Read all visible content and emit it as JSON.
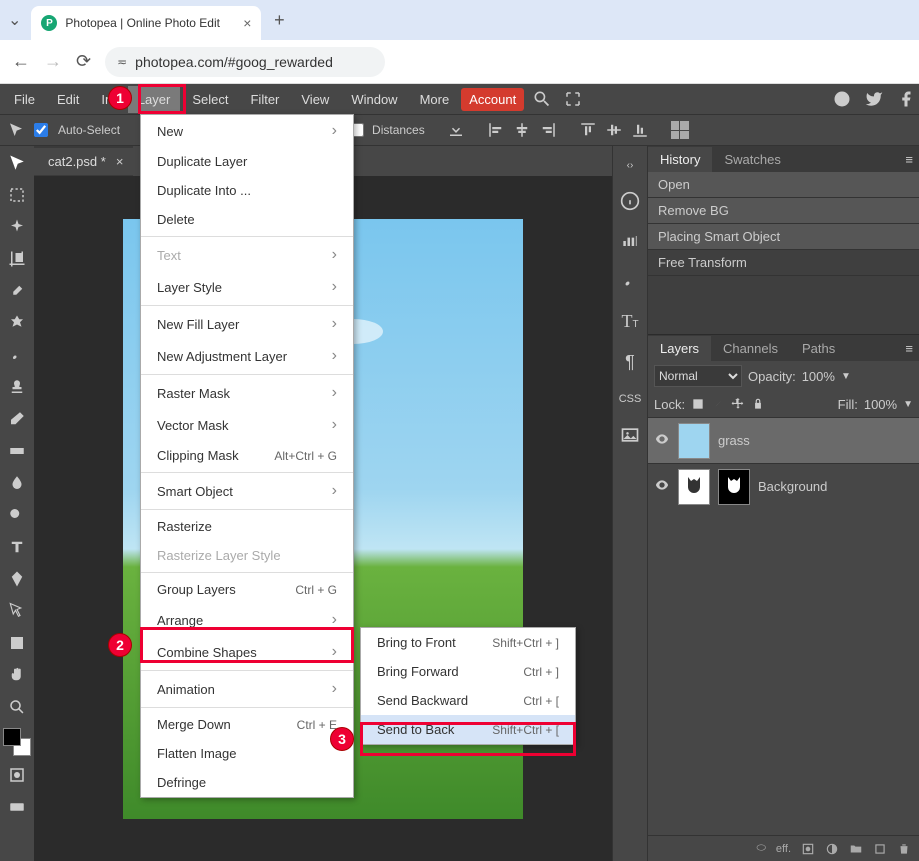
{
  "browser": {
    "tab_title": "Photopea | Online Photo Edit",
    "url": "photopea.com/#goog_rewarded"
  },
  "menubar": {
    "items": [
      "File",
      "Edit",
      "Im",
      "Layer",
      "Select",
      "Filter",
      "View",
      "Window",
      "More"
    ],
    "account": "Account"
  },
  "optbar": {
    "autoselect": "Auto-Select",
    "distances": "Distances"
  },
  "doc_tab": "cat2.psd *",
  "layer_menu": [
    {
      "label": "New",
      "sub": true
    },
    {
      "label": "Duplicate Layer"
    },
    {
      "label": "Duplicate Into ..."
    },
    {
      "label": "Delete"
    },
    {
      "hr": true
    },
    {
      "label": "Text",
      "sub": true,
      "disabled": true
    },
    {
      "label": "Layer Style",
      "sub": true
    },
    {
      "hr": true
    },
    {
      "label": "New Fill Layer",
      "sub": true
    },
    {
      "label": "New Adjustment Layer",
      "sub": true
    },
    {
      "hr": true
    },
    {
      "label": "Raster Mask",
      "sub": true
    },
    {
      "label": "Vector Mask",
      "sub": true
    },
    {
      "label": "Clipping Mask",
      "shortcut": "Alt+Ctrl + G"
    },
    {
      "hr": true
    },
    {
      "label": "Smart Object",
      "sub": true
    },
    {
      "hr": true
    },
    {
      "label": "Rasterize"
    },
    {
      "label": "Rasterize Layer Style",
      "disabled": true
    },
    {
      "hr": true
    },
    {
      "label": "Group Layers",
      "shortcut": "Ctrl + G"
    },
    {
      "label": "Arrange",
      "sub": true
    },
    {
      "label": "Combine Shapes",
      "sub": true
    },
    {
      "hr": true
    },
    {
      "label": "Animation",
      "sub": true
    },
    {
      "hr": true
    },
    {
      "label": "Merge Down",
      "shortcut": "Ctrl + E"
    },
    {
      "label": "Flatten Image"
    },
    {
      "label": "Defringe"
    }
  ],
  "arrange_menu": [
    {
      "label": "Bring to Front",
      "shortcut": "Shift+Ctrl + ]"
    },
    {
      "label": "Bring Forward",
      "shortcut": "Ctrl + ]"
    },
    {
      "label": "Send Backward",
      "shortcut": "Ctrl + ["
    },
    {
      "label": "Send to Back",
      "shortcut": "Shift+Ctrl + [",
      "hl": true
    }
  ],
  "history": {
    "tab1": "History",
    "tab2": "Swatches",
    "items": [
      "Open",
      "Remove BG",
      "Placing Smart Object",
      "Free Transform"
    ]
  },
  "layers_panel": {
    "tab1": "Layers",
    "tab2": "Channels",
    "tab3": "Paths",
    "blend": "Normal",
    "opacity_lbl": "Opacity:",
    "opacity": "100%",
    "lock_lbl": "Lock:",
    "fill_lbl": "Fill:",
    "fill": "100%",
    "l1": "grass",
    "l2": "Background"
  },
  "rstrip": {
    "css": "CSS"
  }
}
